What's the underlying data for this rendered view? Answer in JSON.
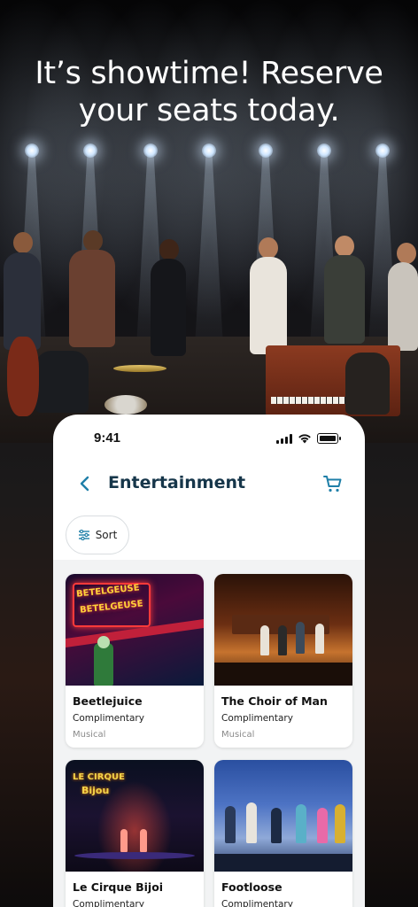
{
  "hero": {
    "headline_line1": "It’s showtime! Reserve",
    "headline_line2": "your seats today."
  },
  "status_bar": {
    "time": "9:41"
  },
  "nav": {
    "back_icon": "chevron-left-icon",
    "title": "Entertainment",
    "cart_icon": "cart-icon"
  },
  "sort": {
    "label": "Sort",
    "icon": "sliders-icon"
  },
  "colors": {
    "accent": "#1f7fa8",
    "title": "#16364a",
    "list_bg": "#f2f3f4"
  },
  "shows": [
    {
      "title": "Beetlejuice",
      "pricing": "Complimentary",
      "category": "Musical",
      "poster_text": "BETELGEUSE"
    },
    {
      "title": "The Choir of Man",
      "pricing": "Complimentary",
      "category": "Musical"
    },
    {
      "title": "Le Cirque Bijoi",
      "pricing": "Complimentary",
      "category": "",
      "poster_text_1": "LE CIRQUE",
      "poster_text_2": "Bijou"
    },
    {
      "title": "Footloose",
      "pricing": "Complimentary",
      "category": ""
    }
  ]
}
